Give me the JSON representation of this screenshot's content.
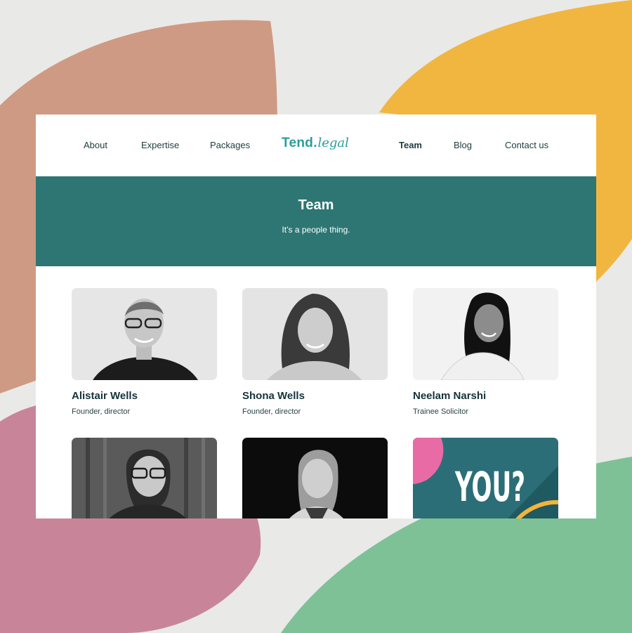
{
  "nav": {
    "items": [
      {
        "label": "About"
      },
      {
        "label": "Expertise"
      },
      {
        "label": "Packages"
      },
      {
        "label": "Team"
      },
      {
        "label": "Blog"
      },
      {
        "label": "Contact us"
      }
    ],
    "active": "Team"
  },
  "logo": {
    "word": "Tend",
    "dot": ".",
    "script": "legal"
  },
  "hero": {
    "title": "Team",
    "subtitle": "It’s a people thing."
  },
  "team": [
    {
      "name": "Alistair Wells",
      "role": "Founder, director"
    },
    {
      "name": "Shona Wells",
      "role": "Founder, director"
    },
    {
      "name": "Neelam Narshi",
      "role": "Trainee Solicitor"
    },
    {
      "name": "",
      "role": ""
    },
    {
      "name": "",
      "role": ""
    },
    {
      "name": "",
      "role": ""
    }
  ],
  "recruit_card": {
    "text": "YOU?"
  },
  "colors": {
    "brand_teal": "#2a9d9a",
    "hero_bg": "#2d7673",
    "text_dark": "#16343a",
    "blob_terracotta": "#cf9a83",
    "blob_mustard": "#f1b640",
    "blob_pink": "#c8859a",
    "blob_green": "#7fc196"
  }
}
